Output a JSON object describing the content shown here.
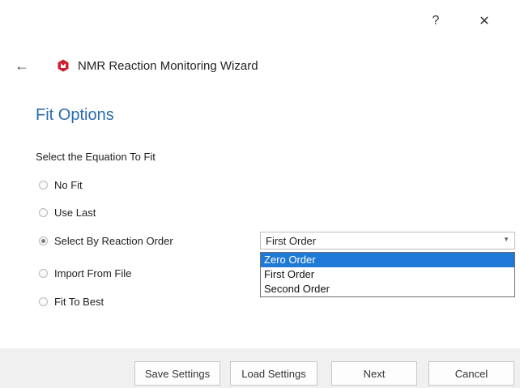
{
  "window": {
    "help_label": "?",
    "close_label": "✕"
  },
  "header": {
    "back_icon": "back-arrow-icon",
    "logo_icon": "app-logo-icon",
    "title": "NMR Reaction Monitoring Wizard"
  },
  "section": {
    "title": "Fit Options",
    "equation_label": "Select the Equation To Fit"
  },
  "options": [
    {
      "label": "No Fit",
      "checked": false
    },
    {
      "label": "Use Last",
      "checked": false
    },
    {
      "label": "Select By Reaction Order",
      "checked": true
    },
    {
      "label": "Import From File",
      "checked": false
    },
    {
      "label": "Fit To Best",
      "checked": false
    }
  ],
  "reaction_order": {
    "selected_value": "First Order",
    "dropdown_items": [
      {
        "label": "Zero Order",
        "highlighted": true
      },
      {
        "label": "First Order",
        "highlighted": false
      },
      {
        "label": "Second Order",
        "highlighted": false
      }
    ]
  },
  "footer": {
    "save_label": "Save Settings",
    "load_label": "Load Settings",
    "next_label": "Next",
    "cancel_label": "Cancel"
  },
  "colors": {
    "accent": "#2a6cb0",
    "selection": "#1e7ad6",
    "logo": "#c8202e",
    "footer_bg": "#f0f0f0"
  }
}
